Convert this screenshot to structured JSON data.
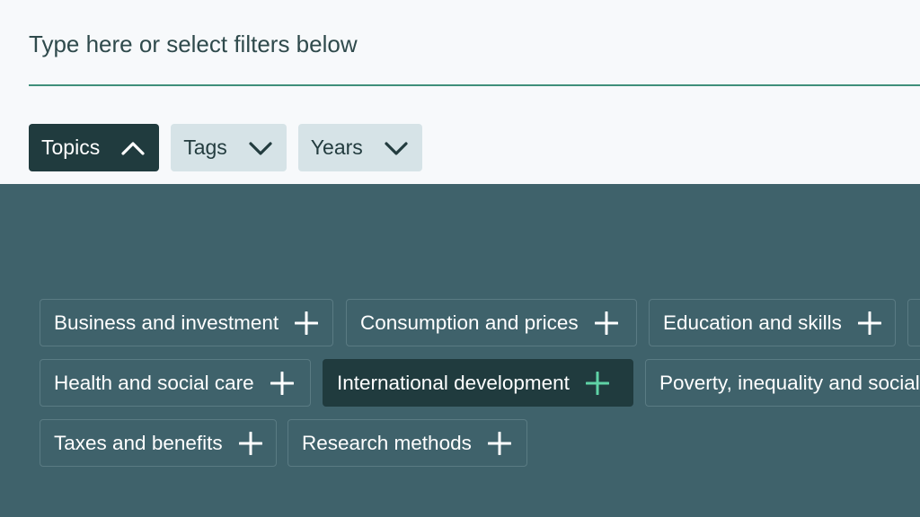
{
  "search": {
    "placeholder": "Type here or select filters below"
  },
  "filters": [
    {
      "label": "Topics",
      "state": "expanded",
      "icon": "chevron-up-icon"
    },
    {
      "label": "Tags",
      "state": "collapsed",
      "icon": "chevron-down-icon"
    },
    {
      "label": "Years",
      "state": "collapsed",
      "icon": "chevron-down-icon"
    }
  ],
  "topics": [
    {
      "label": "Business and investment",
      "selected": false
    },
    {
      "label": "Consumption and prices",
      "selected": false
    },
    {
      "label": "Education and skills",
      "selected": false
    },
    {
      "label": "Health and social care",
      "selected": false
    },
    {
      "label": "International development",
      "selected": true
    },
    {
      "label": "Poverty, inequality and social",
      "selected": false
    },
    {
      "label": "Taxes and benefits",
      "selected": false
    },
    {
      "label": "Research methods",
      "selected": false
    }
  ],
  "colors": {
    "accent": "#3f8f7a",
    "panel": "#3f626b",
    "dark": "#203b3e",
    "selected_plus": "#5fd3a6"
  }
}
